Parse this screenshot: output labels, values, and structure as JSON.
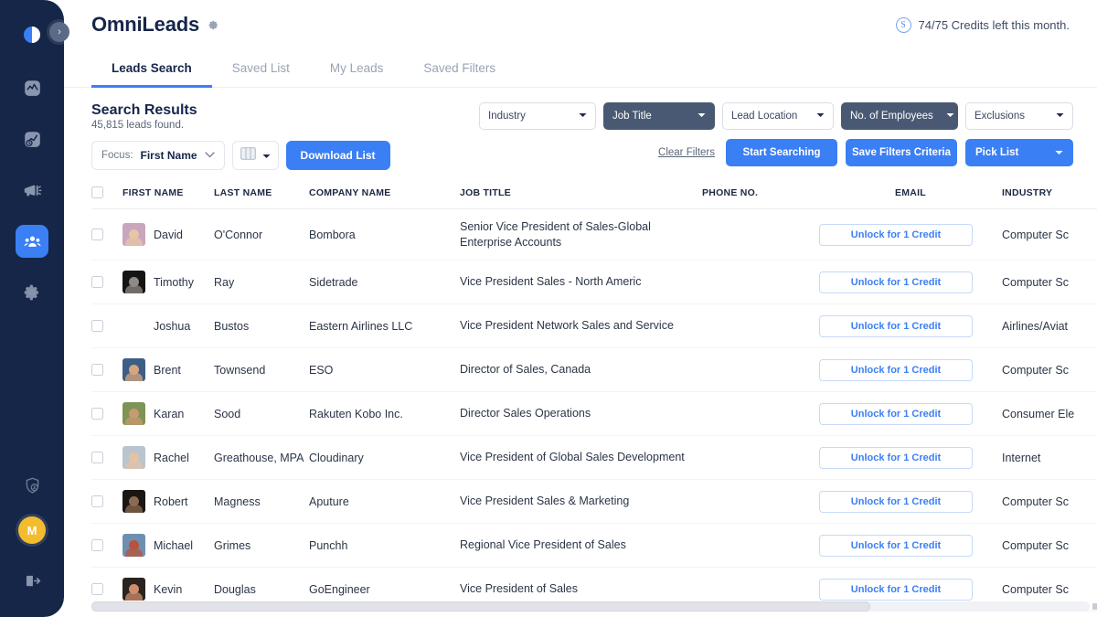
{
  "sidebar": {
    "expand_label": "›",
    "items": [
      {
        "name": "logo",
        "icon": "contrast-logo-icon"
      },
      {
        "name": "analytics",
        "icon": "activity-chart-icon"
      },
      {
        "name": "reports",
        "icon": "report-clock-icon"
      },
      {
        "name": "campaigns",
        "icon": "megaphone-icon"
      },
      {
        "name": "leads",
        "icon": "people-group-icon",
        "active": true
      },
      {
        "name": "settings",
        "icon": "gear-icon"
      }
    ],
    "bottom": [
      {
        "name": "privacy",
        "icon": "shield-user-icon"
      },
      {
        "name": "account",
        "icon": "avatar-initial",
        "initial": "M"
      },
      {
        "name": "logout",
        "icon": "logout-icon"
      }
    ]
  },
  "header": {
    "title": "OmniLeads",
    "settings_icon": "gear-icon",
    "credits_icon": "credit-coin-icon",
    "credits_text": "74/75 Credits left this month."
  },
  "tabs": [
    {
      "label": "Leads Search",
      "active": true
    },
    {
      "label": "Saved List",
      "active": false
    },
    {
      "label": "My Leads",
      "active": false
    },
    {
      "label": "Saved Filters",
      "active": false
    }
  ],
  "results": {
    "title": "Search Results",
    "subtitle": "45,815 leads found.",
    "focus_label": "Focus:",
    "focus_value": "First Name",
    "columns_icon": "columns-icon",
    "download_label": "Download List"
  },
  "filters": {
    "dropdowns": [
      {
        "label": "Industry",
        "style": "light"
      },
      {
        "label": "Job Title",
        "style": "dark"
      },
      {
        "label": "Lead Location",
        "style": "light"
      },
      {
        "label": "No. of Employees",
        "style": "dark"
      },
      {
        "label": "Exclusions",
        "style": "light"
      }
    ],
    "clear_label": "Clear Filters",
    "start_label": "Start Searching",
    "save_label": "Save Filters Criteria",
    "pick_label": "Pick List"
  },
  "table": {
    "headers": [
      "FIRST NAME",
      "LAST NAME",
      "COMPANY NAME",
      "JOB TITLE",
      "PHONE NO.",
      "EMAIL",
      "INDUSTRY"
    ],
    "unlock_label": "Unlock for 1 Credit",
    "rows": [
      {
        "first": "David",
        "last": "O'Connor",
        "company": "Bombora",
        "job": "Senior Vice President of Sales-Global Enterprise Accounts",
        "phone": "",
        "industry": "Computer Sc",
        "avatar": true,
        "avatar_bg": "#c9a6bd",
        "avatar_face": "#e8c4a8"
      },
      {
        "first": "Timothy",
        "last": "Ray",
        "company": "Sidetrade",
        "job": "Vice President Sales - North Americ",
        "phone": "",
        "industry": "Computer Sc",
        "avatar": true,
        "avatar_bg": "#141414",
        "avatar_face": "#8f8a85"
      },
      {
        "first": "Joshua",
        "last": "Bustos",
        "company": "Eastern Airlines LLC",
        "job": "Vice President Network Sales and Service",
        "phone": "",
        "industry": "Airlines/Aviat",
        "avatar": false,
        "avatar_bg": "",
        "avatar_face": ""
      },
      {
        "first": "Brent",
        "last": "Townsend",
        "company": "ESO",
        "job": "Director of Sales, Canada",
        "phone": "",
        "industry": "Computer Sc",
        "avatar": true,
        "avatar_bg": "#3d5f86",
        "avatar_face": "#d8a57e"
      },
      {
        "first": "Karan",
        "last": "Sood",
        "company": "Rakuten Kobo Inc.",
        "job": "Director Sales Operations",
        "phone": "",
        "industry": "Consumer Ele",
        "avatar": true,
        "avatar_bg": "#7e9454",
        "avatar_face": "#c89a72"
      },
      {
        "first": "Rachel",
        "last": "Greathouse, MPA",
        "company": "Cloudinary",
        "job": "Vice President of Global Sales Development",
        "phone": "",
        "industry": "Internet",
        "avatar": true,
        "avatar_bg": "#b9c4cf",
        "avatar_face": "#e3c3a5"
      },
      {
        "first": "Robert",
        "last": "Magness",
        "company": "Aputure",
        "job": "Vice President Sales & Marketing",
        "phone": "",
        "industry": "Computer Sc",
        "avatar": true,
        "avatar_bg": "#1a1614",
        "avatar_face": "#8c6a52"
      },
      {
        "first": "Michael",
        "last": "Grimes",
        "company": "Punchh",
        "job": "Regional Vice President of Sales",
        "phone": "",
        "industry": "Computer Sc",
        "avatar": true,
        "avatar_bg": "#6f8fb0",
        "avatar_face": "#b8523c"
      },
      {
        "first": "Kevin",
        "last": "Douglas",
        "company": "GoEngineer",
        "job": "Vice President of Sales",
        "phone": "",
        "industry": "Computer Sc",
        "avatar": true,
        "avatar_bg": "#2a2320",
        "avatar_face": "#cf8d6c"
      }
    ]
  },
  "colors": {
    "accent_blue": "#3b7ff5",
    "sidebar_navy": "#152648",
    "dark_dropdown": "#4a5973",
    "avatar_yellow": "#f3bc2e"
  }
}
